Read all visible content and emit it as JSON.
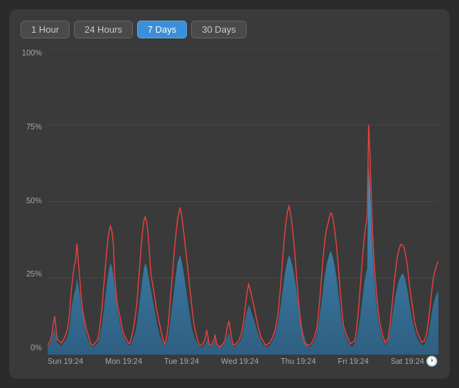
{
  "toolbar": {
    "tabs": [
      {
        "id": "1hour",
        "label": "1 Hour",
        "active": false
      },
      {
        "id": "24hours",
        "label": "24 Hours",
        "active": false
      },
      {
        "id": "7days",
        "label": "7 Days",
        "active": true
      },
      {
        "id": "30days",
        "label": "30 Days",
        "active": false
      }
    ]
  },
  "yAxis": {
    "labels": [
      "100%",
      "75%",
      "50%",
      "25%",
      "0%"
    ]
  },
  "xAxis": {
    "labels": [
      "Sun 19:24",
      "Mon 19:24",
      "Tue 19:24",
      "Wed 19:24",
      "Thu 19:24",
      "Fri 19:24",
      "Sat 19:24"
    ]
  },
  "colors": {
    "blue": "#4a9fd4",
    "red": "#e84040",
    "grid": "#555555",
    "background": "#3a3a3a"
  }
}
